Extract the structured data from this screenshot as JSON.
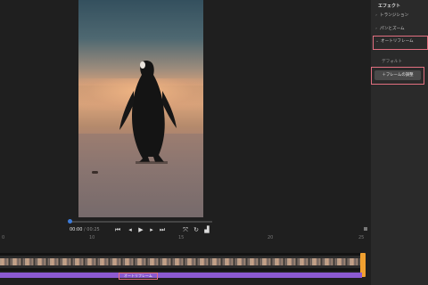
{
  "panel": {
    "title": "エフェクト",
    "items": [
      {
        "label": "トランジション",
        "expanded": false
      },
      {
        "label": "パンとズーム",
        "expanded": false
      },
      {
        "label": "オートリフレーム",
        "expanded": true
      }
    ],
    "default_label": "デフォルト",
    "adjust_button": "フレームの調整"
  },
  "player": {
    "current_time": "00:00",
    "separator": "/",
    "duration": "00:25",
    "progress": 0.01
  },
  "ruler": {
    "ticks": [
      "0",
      "10",
      "15",
      "20",
      "25"
    ]
  },
  "timeline": {
    "effect_label": "オートリフレーム"
  },
  "colors": {
    "accent": "#3d7bd9",
    "highlight": "#e26f80",
    "effect_bar": "#8c5ad1",
    "clip_handle": "#f0a030"
  },
  "icons": [
    "skip-back-icon",
    "step-back-icon",
    "play-icon",
    "step-forward-icon",
    "skip-forward-icon",
    "fit-icon",
    "loop-icon",
    "volume-icon"
  ]
}
